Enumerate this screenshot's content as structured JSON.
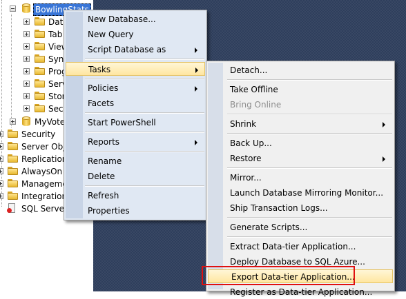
{
  "object_explorer": {
    "database_node": "BowlingStats",
    "db_children": [
      "Data",
      "Tab",
      "View",
      "Syno",
      "Prog",
      "Serv",
      "Stor",
      "Secu"
    ],
    "other_database": "MyVote",
    "server_nodes": [
      "Security",
      "Server Obje",
      "Replication",
      "AlwaysOn H",
      "Manageme",
      "Integration",
      "SQL Server"
    ]
  },
  "context_menu": {
    "items": [
      {
        "label": "New Database..."
      },
      {
        "label": "New Query"
      },
      {
        "label": "Script Database as"
      },
      {
        "label": "Tasks"
      },
      {
        "label": "Policies"
      },
      {
        "label": "Facets"
      },
      {
        "label": "Start PowerShell"
      },
      {
        "label": "Reports"
      },
      {
        "label": "Rename"
      },
      {
        "label": "Delete"
      },
      {
        "label": "Refresh"
      },
      {
        "label": "Properties"
      }
    ]
  },
  "tasks_submenu": {
    "items": [
      {
        "label": "Detach..."
      },
      {
        "label": "Take Offline"
      },
      {
        "label": "Bring Online"
      },
      {
        "label": "Shrink"
      },
      {
        "label": "Back Up..."
      },
      {
        "label": "Restore"
      },
      {
        "label": "Mirror..."
      },
      {
        "label": "Launch Database Mirroring Monitor..."
      },
      {
        "label": "Ship Transaction Logs..."
      },
      {
        "label": "Generate Scripts..."
      },
      {
        "label": "Extract Data-tier Application..."
      },
      {
        "label": "Deploy Database to SQL Azure..."
      },
      {
        "label": "Export Data-tier Application..."
      },
      {
        "label": "Register as Data-tier Application..."
      }
    ]
  },
  "colors": {
    "selection": "#3875d7",
    "menu_highlight": "#ffe6a0",
    "callout": "#e01010",
    "desktop": "#2e3e5c"
  }
}
